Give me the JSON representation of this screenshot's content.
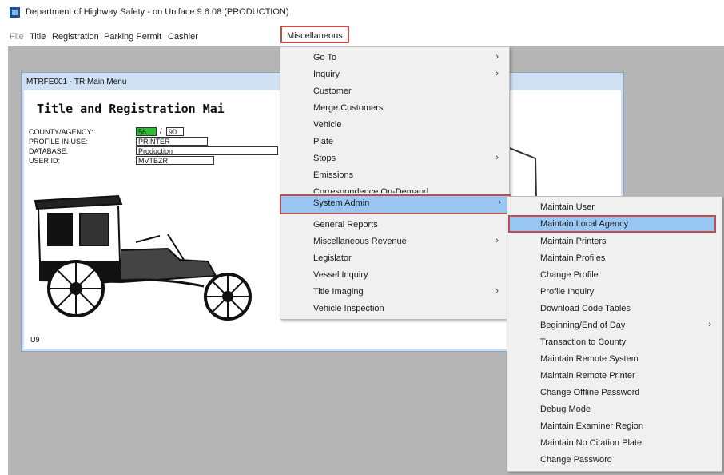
{
  "app": {
    "title": "Department of Highway Safety - on Uniface 9.6.08 (PRODUCTION)"
  },
  "menubar": [
    {
      "label": "File"
    },
    {
      "label": "Title"
    },
    {
      "label": "Registration"
    },
    {
      "label": "Parking Permit"
    },
    {
      "label": "Cashier"
    },
    {
      "label": "Miscellaneous"
    }
  ],
  "window": {
    "title": "MTRFE001 - TR Main Menu",
    "heading": "Title and Registration Mai",
    "fields": {
      "county_label": "COUNTY/AGENCY:",
      "county_value": "56",
      "agency_value": "90",
      "slash": "/",
      "profile_label": "PROFILE IN USE:",
      "profile_value": "PRINTER",
      "database_label": "DATABASE:",
      "database_value": "Production",
      "userid_label": "USER ID:",
      "userid_value": "MVTBZR"
    },
    "footer_code": "U9"
  },
  "misc_menu": {
    "items": [
      {
        "label": "Go To",
        "submenu": true
      },
      {
        "label": "Inquiry",
        "submenu": true
      },
      {
        "label": "Customer",
        "submenu": false
      },
      {
        "label": "Merge Customers",
        "submenu": false
      },
      {
        "label": "Vehicle",
        "submenu": false
      },
      {
        "label": "Plate",
        "submenu": false
      },
      {
        "label": "Stops",
        "submenu": true
      },
      {
        "label": "Emissions",
        "submenu": false
      },
      {
        "label": "Correspondence On-Demand",
        "submenu": false
      },
      {
        "label": "System Admin",
        "submenu": true,
        "highlighted": true
      },
      {
        "label": "General Reports",
        "submenu": false
      },
      {
        "label": "Miscellaneous Revenue",
        "submenu": true
      },
      {
        "label": "Legislator",
        "submenu": false
      },
      {
        "label": "Vessel Inquiry",
        "submenu": false
      },
      {
        "label": "Title Imaging",
        "submenu": true
      },
      {
        "label": "Vehicle Inspection",
        "submenu": false
      }
    ]
  },
  "sysadmin_menu": {
    "items": [
      {
        "label": "Maintain User",
        "submenu": false
      },
      {
        "label": "Maintain Local Agency",
        "submenu": false,
        "highlighted": true
      },
      {
        "label": "Maintain Printers",
        "submenu": false
      },
      {
        "label": "Maintain Profiles",
        "submenu": false
      },
      {
        "label": "Change Profile",
        "submenu": false
      },
      {
        "label": "Profile Inquiry",
        "submenu": false
      },
      {
        "label": "Download Code Tables",
        "submenu": false
      },
      {
        "label": "Beginning/End of Day",
        "submenu": true
      },
      {
        "label": "Transaction to County",
        "submenu": false
      },
      {
        "label": "Maintain Remote System",
        "submenu": false
      },
      {
        "label": "Maintain Remote Printer",
        "submenu": false
      },
      {
        "label": "Change Offline Password",
        "submenu": false
      },
      {
        "label": "Debug Mode",
        "submenu": false
      },
      {
        "label": "Maintain Examiner Region",
        "submenu": false
      },
      {
        "label": "Maintain No Citation Plate",
        "submenu": false
      },
      {
        "label": "Change Password",
        "submenu": false
      }
    ]
  },
  "icons": {
    "app": "app-window-icon",
    "submenu": "chevron-right-icon"
  },
  "colors": {
    "highlight": "#99c7f4",
    "callout_border": "#c74a4a",
    "green_field": "#2dbb33"
  }
}
